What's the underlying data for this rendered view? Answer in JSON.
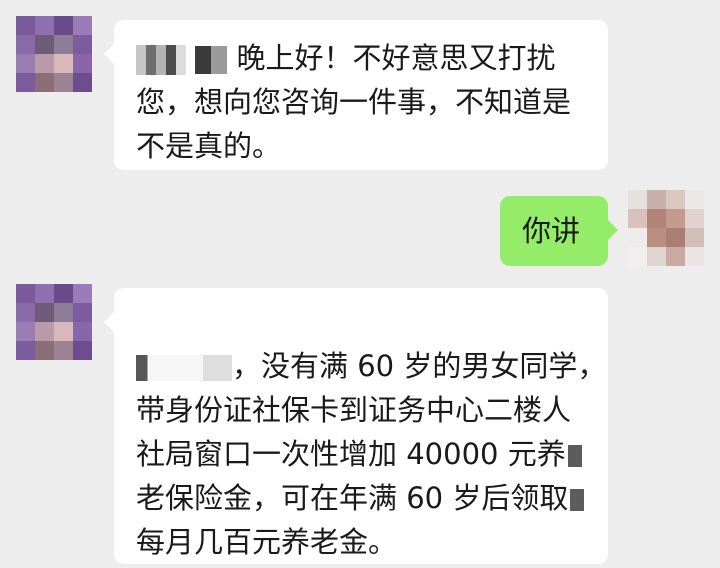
{
  "colors": {
    "background": "#ededed",
    "incoming_bubble": "#ffffff",
    "outgoing_bubble": "#95ec69",
    "text": "#1a1a1a"
  },
  "messages": [
    {
      "direction": "incoming",
      "lines": [
        "晚上好！不好意思又打扰",
        "您，想向您咨询一件事，不知道是",
        "不是真的。"
      ]
    },
    {
      "direction": "outgoing",
      "lines": [
        "你讲"
      ]
    },
    {
      "direction": "incoming",
      "lines": [
        "，没有满 60 岁的男女同学，",
        "带身份证社保卡到证务中心二楼人",
        "社局窗口一次性增加 40000 元养",
        "老保险金，可在年满 60 岁后领取",
        "每月几百元养老金。"
      ]
    }
  ]
}
